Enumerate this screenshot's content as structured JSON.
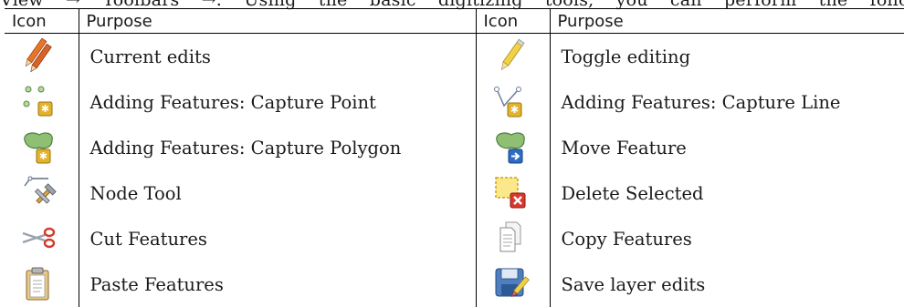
{
  "top_clipped_line": "View → Toolbars →. Using the basic digitizing tools, you can perform the following",
  "table": {
    "headers": [
      "Icon",
      "Purpose",
      "Icon",
      "Purpose"
    ],
    "rows": [
      {
        "left": {
          "icon": "current-edits-icon",
          "purpose": "Current edits"
        },
        "right": {
          "icon": "toggle-editing-icon",
          "purpose": "Toggle editing"
        }
      },
      {
        "left": {
          "icon": "capture-point-icon",
          "purpose": "Adding Features: Capture Point"
        },
        "right": {
          "icon": "capture-line-icon",
          "purpose": "Adding Features: Capture Line"
        }
      },
      {
        "left": {
          "icon": "capture-polygon-icon",
          "purpose": "Adding Features: Capture Polygon"
        },
        "right": {
          "icon": "move-feature-icon",
          "purpose": "Move Feature"
        }
      },
      {
        "left": {
          "icon": "node-tool-icon",
          "purpose": "Node Tool"
        },
        "right": {
          "icon": "delete-selected-icon",
          "purpose": "Delete Selected"
        }
      },
      {
        "left": {
          "icon": "cut-features-icon",
          "purpose": "Cut Features"
        },
        "right": {
          "icon": "copy-features-icon",
          "purpose": "Copy Features"
        }
      },
      {
        "left": {
          "icon": "paste-features-icon",
          "purpose": "Paste Features"
        },
        "right": {
          "icon": "save-layer-edits-icon",
          "purpose": "Save layer edits"
        }
      }
    ]
  },
  "colors": {
    "rule": "#000000",
    "text": "#1a1a1a",
    "pencil_orange": "#e8752a",
    "pencil_yellow": "#f0d24a",
    "polygon_green": "#8fbf73",
    "star_badge": "#e3b32b",
    "delete_red": "#d9382e",
    "move_blue": "#2e6bc4",
    "scissors_red": "#d33a2c",
    "disk_blue": "#4f7fc0"
  }
}
